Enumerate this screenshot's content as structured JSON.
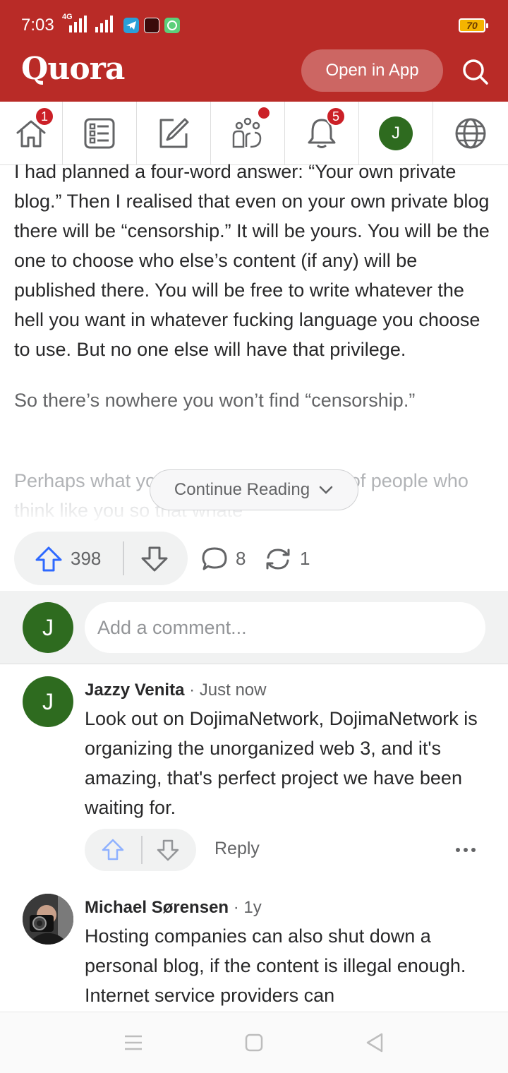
{
  "status_bar": {
    "time": "7:03",
    "network": "4G",
    "battery": "70"
  },
  "header": {
    "logo": "Quora",
    "open_in_app": "Open in App",
    "brand_color": "#b92b27"
  },
  "nav": {
    "home_badge": "1",
    "notifications_badge": "5",
    "profile_initial": "J",
    "items": [
      "home-icon",
      "following-icon",
      "write-icon",
      "spaces-icon",
      "notifications-icon",
      "profile-avatar",
      "language-icon"
    ]
  },
  "answer": {
    "para1": "I had planned a four-word answer: “Your own private blog.” Then I realised that even on your own private blog there will be “censorship.” It will be yours. You will be the one to choose who else’s content (if any) will be published there. You will be free to write whatever the hell you want in whatever fucking language you choose to use. But no one else will have that privilege.",
    "para2": "So there’s nowhere you won’t find “censorship.”",
    "para3": "Perhaps what you want is a community of people who think like you so that whate",
    "continue_reading": "Continue Reading"
  },
  "actions": {
    "upvotes": "398",
    "comments": "8",
    "shares": "1"
  },
  "add_comment": {
    "avatar_initial": "J",
    "placeholder": "Add a comment..."
  },
  "comments": [
    {
      "author": "Jazzy Venita",
      "time": "· Just now",
      "avatar_initial": "J",
      "text": "Look out on DojimaNetwork, DojimaNetwork is organizing the unorganized web 3, and it's amazing, that's perfect project we have been waiting for.",
      "reply": "Reply"
    },
    {
      "author": "Michael Sørensen",
      "time": "· 1y",
      "text": "Hosting companies can also shut down a personal blog, if the content is illegal enough. Internet service providers can"
    }
  ]
}
